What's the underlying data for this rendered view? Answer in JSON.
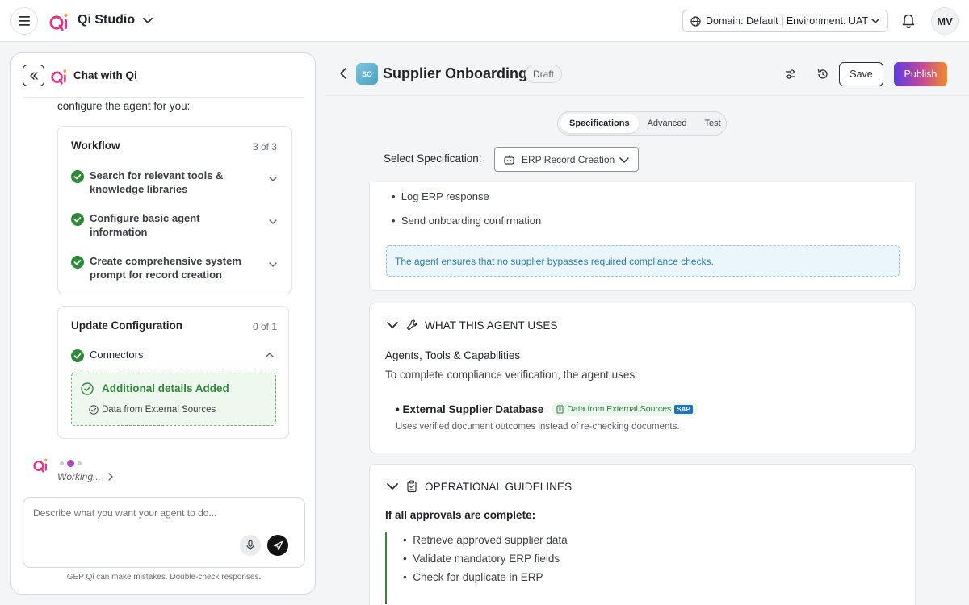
{
  "app": {
    "name": "Qi Studio",
    "domain_selector": "Domain: Default | Environment: UAT",
    "user_initials": "MV",
    "colors": {
      "accent": "#5a3ce0",
      "success": "#2f8a3a",
      "info": "#2b7fa8"
    }
  },
  "chat": {
    "title": "Chat with Qi",
    "intro": "configure the agent for you:",
    "workflow": {
      "title": "Workflow",
      "count": "3 of 3",
      "steps": [
        {
          "label": "Search for relevant tools & knowledge libraries"
        },
        {
          "label": "Configure basic agent information"
        },
        {
          "label": "Create comprehensive system prompt for record creation"
        }
      ]
    },
    "update": {
      "title": "Update Configuration",
      "count": "0 of 1",
      "item": "Connectors",
      "added_title": "Additional details Added",
      "added_sub": "Data from External Sources"
    },
    "working": "Working...",
    "input_placeholder": "Describe what you want your agent to do...",
    "disclaimer": "GEP Qi can make mistakes. Double-check responses."
  },
  "agent": {
    "badge": "SO",
    "title": "Supplier Onboarding",
    "status": "Draft",
    "save_label": "Save",
    "publish_label": "Publish",
    "tabs": [
      "Specifications",
      "Advanced",
      "Test"
    ],
    "active_tab": "Specifications",
    "spec_label": "Select Specification:",
    "spec_value": "ERP Record Creation"
  },
  "sections": {
    "top": {
      "bullets": [
        "Log ERP response",
        "Send onboarding confirmation"
      ],
      "note": "The agent ensures that no supplier bypasses required compliance checks."
    },
    "uses": {
      "title": "WHAT THIS AGENT USES",
      "subtitle": "Agents, Tools & Capabilities",
      "text": "To complete compliance verification, the agent uses:",
      "tool_name": "• External Supplier Database",
      "tool_chip": "Data from External Sources",
      "tool_badge": "SAP",
      "tool_desc": "Uses verified document outcomes instead of re-checking documents."
    },
    "guidelines": {
      "title": "OPERATIONAL GUIDELINES",
      "condition": "If all approvals are complete:",
      "bullets": [
        "Retrieve approved supplier data",
        "Validate mandatory ERP fields",
        "Check for duplicate in ERP"
      ]
    }
  }
}
